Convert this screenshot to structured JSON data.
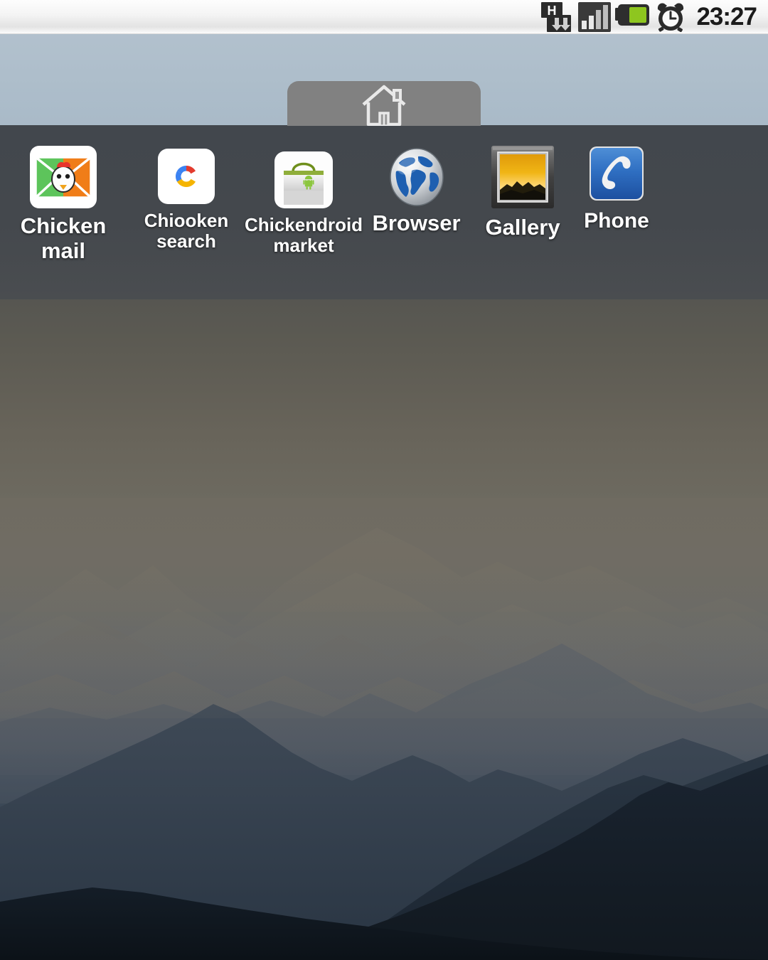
{
  "device": {
    "platform": "Android",
    "screen": "home-screen"
  },
  "status_bar": {
    "time": "23:27",
    "icons": [
      {
        "name": "hspa-data-icon",
        "label": "H"
      },
      {
        "name": "signal-bars-icon",
        "label": "signal"
      },
      {
        "name": "battery-icon",
        "label": "battery"
      },
      {
        "name": "alarm-clock-icon",
        "label": "alarm"
      }
    ],
    "colors": {
      "background": "#f4f4f4",
      "text": "#1b1b1b",
      "battery_fill": "#8ec61f"
    }
  },
  "home_tab": {
    "name": "home-tab",
    "icon": "house-icon",
    "color": "#818181"
  },
  "wallpaper": {
    "description": "Hazy mountain range at dusk",
    "sky_color": "#aebecb",
    "haze_color": "#6d6a60",
    "foreground_color": "#171f2a"
  },
  "apps": [
    {
      "id": "chickenmail",
      "label": "Chicken\nmail",
      "icon": "chicken-mail-icon"
    },
    {
      "id": "chiookensearch",
      "label": "Chiooken\nsearch",
      "icon": "chiooken-search-icon"
    },
    {
      "id": "market",
      "label": "Chickendroid\nmarket",
      "icon": "market-bag-icon"
    },
    {
      "id": "browser",
      "label": "Browser",
      "icon": "globe-icon"
    },
    {
      "id": "gallery",
      "label": "Gallery",
      "icon": "picture-frame-icon"
    },
    {
      "id": "phone",
      "label": "Phone",
      "icon": "phone-handset-icon"
    }
  ]
}
